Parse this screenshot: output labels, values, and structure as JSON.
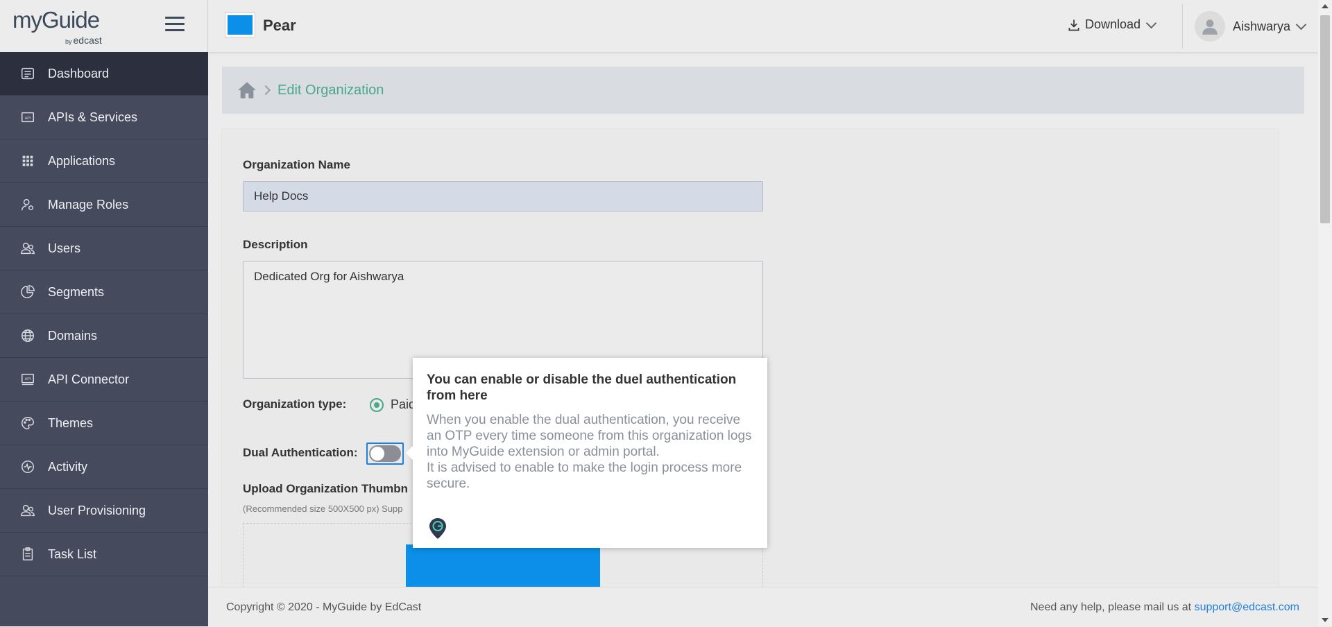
{
  "brand": {
    "logo_text": "myGuide",
    "logo_by": "by",
    "logo_sub": "edcast"
  },
  "sidebar": {
    "items": [
      {
        "label": "Dashboard",
        "icon": "dashboard-icon",
        "active": true
      },
      {
        "label": "APIs & Services",
        "icon": "api-icon"
      },
      {
        "label": "Applications",
        "icon": "grid-icon"
      },
      {
        "label": "Manage Roles",
        "icon": "user-gear-icon"
      },
      {
        "label": "Users",
        "icon": "users-icon"
      },
      {
        "label": "Segments",
        "icon": "pie-chart-icon"
      },
      {
        "label": "Domains",
        "icon": "globe-icon"
      },
      {
        "label": "API Connector",
        "icon": "api-connector-icon"
      },
      {
        "label": "Themes",
        "icon": "palette-icon"
      },
      {
        "label": "Activity",
        "icon": "activity-icon"
      },
      {
        "label": "User Provisioning",
        "icon": "users-icon"
      },
      {
        "label": "Task List",
        "icon": "clipboard-icon"
      }
    ]
  },
  "header": {
    "org_name": "Pear",
    "download_label": "Download",
    "user_name": "Aishwarya"
  },
  "breadcrumb": {
    "current": "Edit Organization"
  },
  "form": {
    "org_name_label": "Organization Name",
    "org_name_value": "Help Docs",
    "description_label": "Description",
    "description_value": "Dedicated Org for Aishwarya",
    "org_type_label": "Organization type:",
    "org_type_value": "Paid",
    "dual_auth_label": "Dual Authentication:",
    "dual_auth_enabled": false,
    "upload_label": "Upload Organization Thumbn",
    "upload_hint": "(Recommended size 500X500 px) Supp"
  },
  "tooltip": {
    "title": "You can enable or disable the duel authentication from here",
    "body_1": "When you enable the dual authentication, you receive an OTP every time someone from this organization logs into MyGuide extension or admin portal.",
    "body_2": "It is advised to enable to make the login process more secure."
  },
  "footer": {
    "copyright": "Copyright © 2020 - MyGuide by EdCast",
    "help_text": "Need any help, please mail us at",
    "support_email": "support@edcast.com"
  },
  "colors": {
    "sidebar_bg": "#454a5c",
    "sidebar_active": "#2b2f3e",
    "accent_green": "#4aa88a",
    "brand_blue": "#0b8fe8",
    "link_blue": "#1f7fd9"
  }
}
